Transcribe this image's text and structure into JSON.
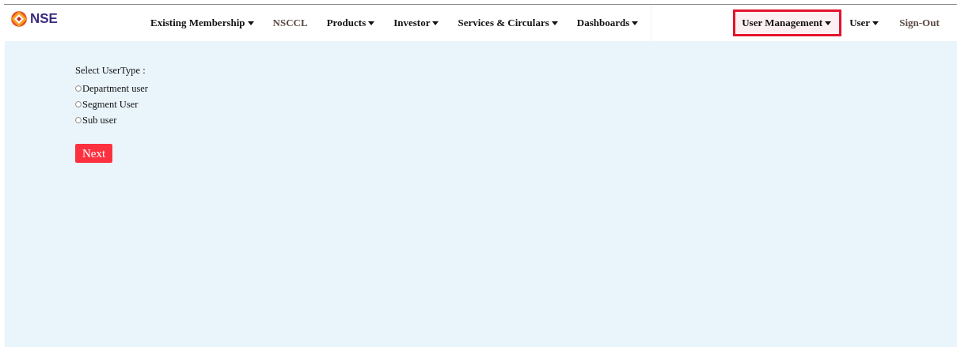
{
  "logo": {
    "text": "NSE"
  },
  "nav": [
    {
      "label": "Existing Membership",
      "kind": "dropdown",
      "highlighted": false
    },
    {
      "label": "NSCCL",
      "kind": "link",
      "highlighted": false
    },
    {
      "label": "Products",
      "kind": "dropdown",
      "highlighted": false
    },
    {
      "label": "Investor",
      "kind": "dropdown",
      "highlighted": false
    },
    {
      "label": "Services & Circulars",
      "kind": "dropdown",
      "highlighted": false
    },
    {
      "label": "Dashboards",
      "kind": "dropdown",
      "highlighted": false
    }
  ],
  "nav_right": [
    {
      "label": "User Management",
      "kind": "dropdown",
      "highlighted": true
    },
    {
      "label": "User",
      "kind": "dropdown",
      "highlighted": false
    },
    {
      "label": "Sign-Out",
      "kind": "link",
      "highlighted": false
    }
  ],
  "form": {
    "label": "Select UserType :",
    "options": [
      {
        "label": "Department user",
        "selected": false
      },
      {
        "label": "Segment User",
        "selected": false
      },
      {
        "label": "Sub user",
        "selected": false
      }
    ],
    "button": "Next"
  }
}
